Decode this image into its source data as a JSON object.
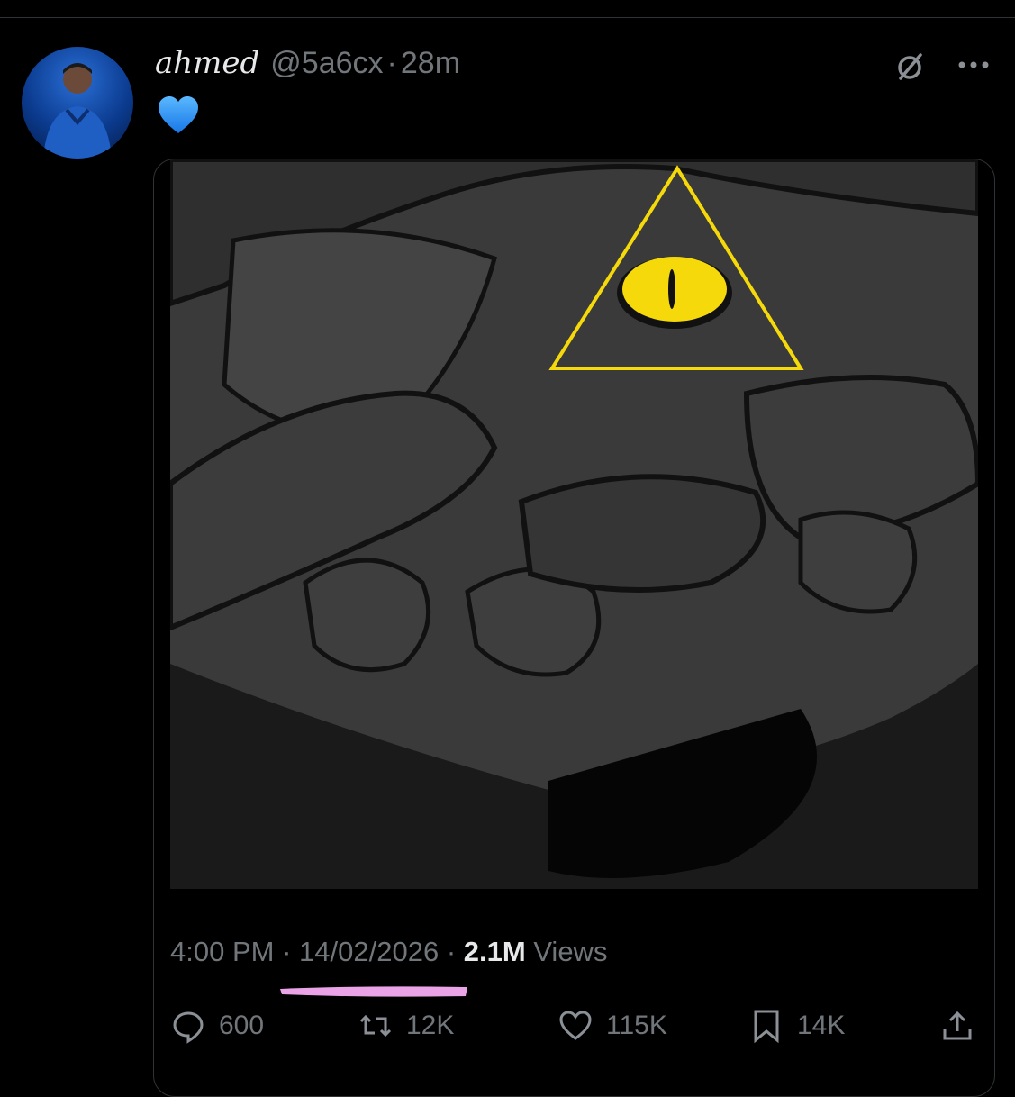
{
  "post": {
    "display_name": "ahmed",
    "handle": "@5a6cx",
    "separator": "·",
    "time_ago": "28m",
    "emoji": "💙",
    "image_icons": [
      "grok-icon",
      "more-icon"
    ]
  },
  "meta": {
    "time": "4:00 PM",
    "sep1": "·",
    "date": "14/02/2026",
    "sep2": "·",
    "views_count": "2.1M",
    "views_label": "Views"
  },
  "actions": {
    "replies": "600",
    "reposts": "12K",
    "likes": "115K",
    "bookmarks": "14K"
  },
  "colors": {
    "background": "#000000",
    "muted_text": "#71767b",
    "primary_text": "#e7e9ea",
    "heart_blue": "#1d9bf0",
    "eye_yellow": "#f5d90a",
    "highlight_pink": "#e9a3e6",
    "art_gray": "#3a3a3a"
  }
}
